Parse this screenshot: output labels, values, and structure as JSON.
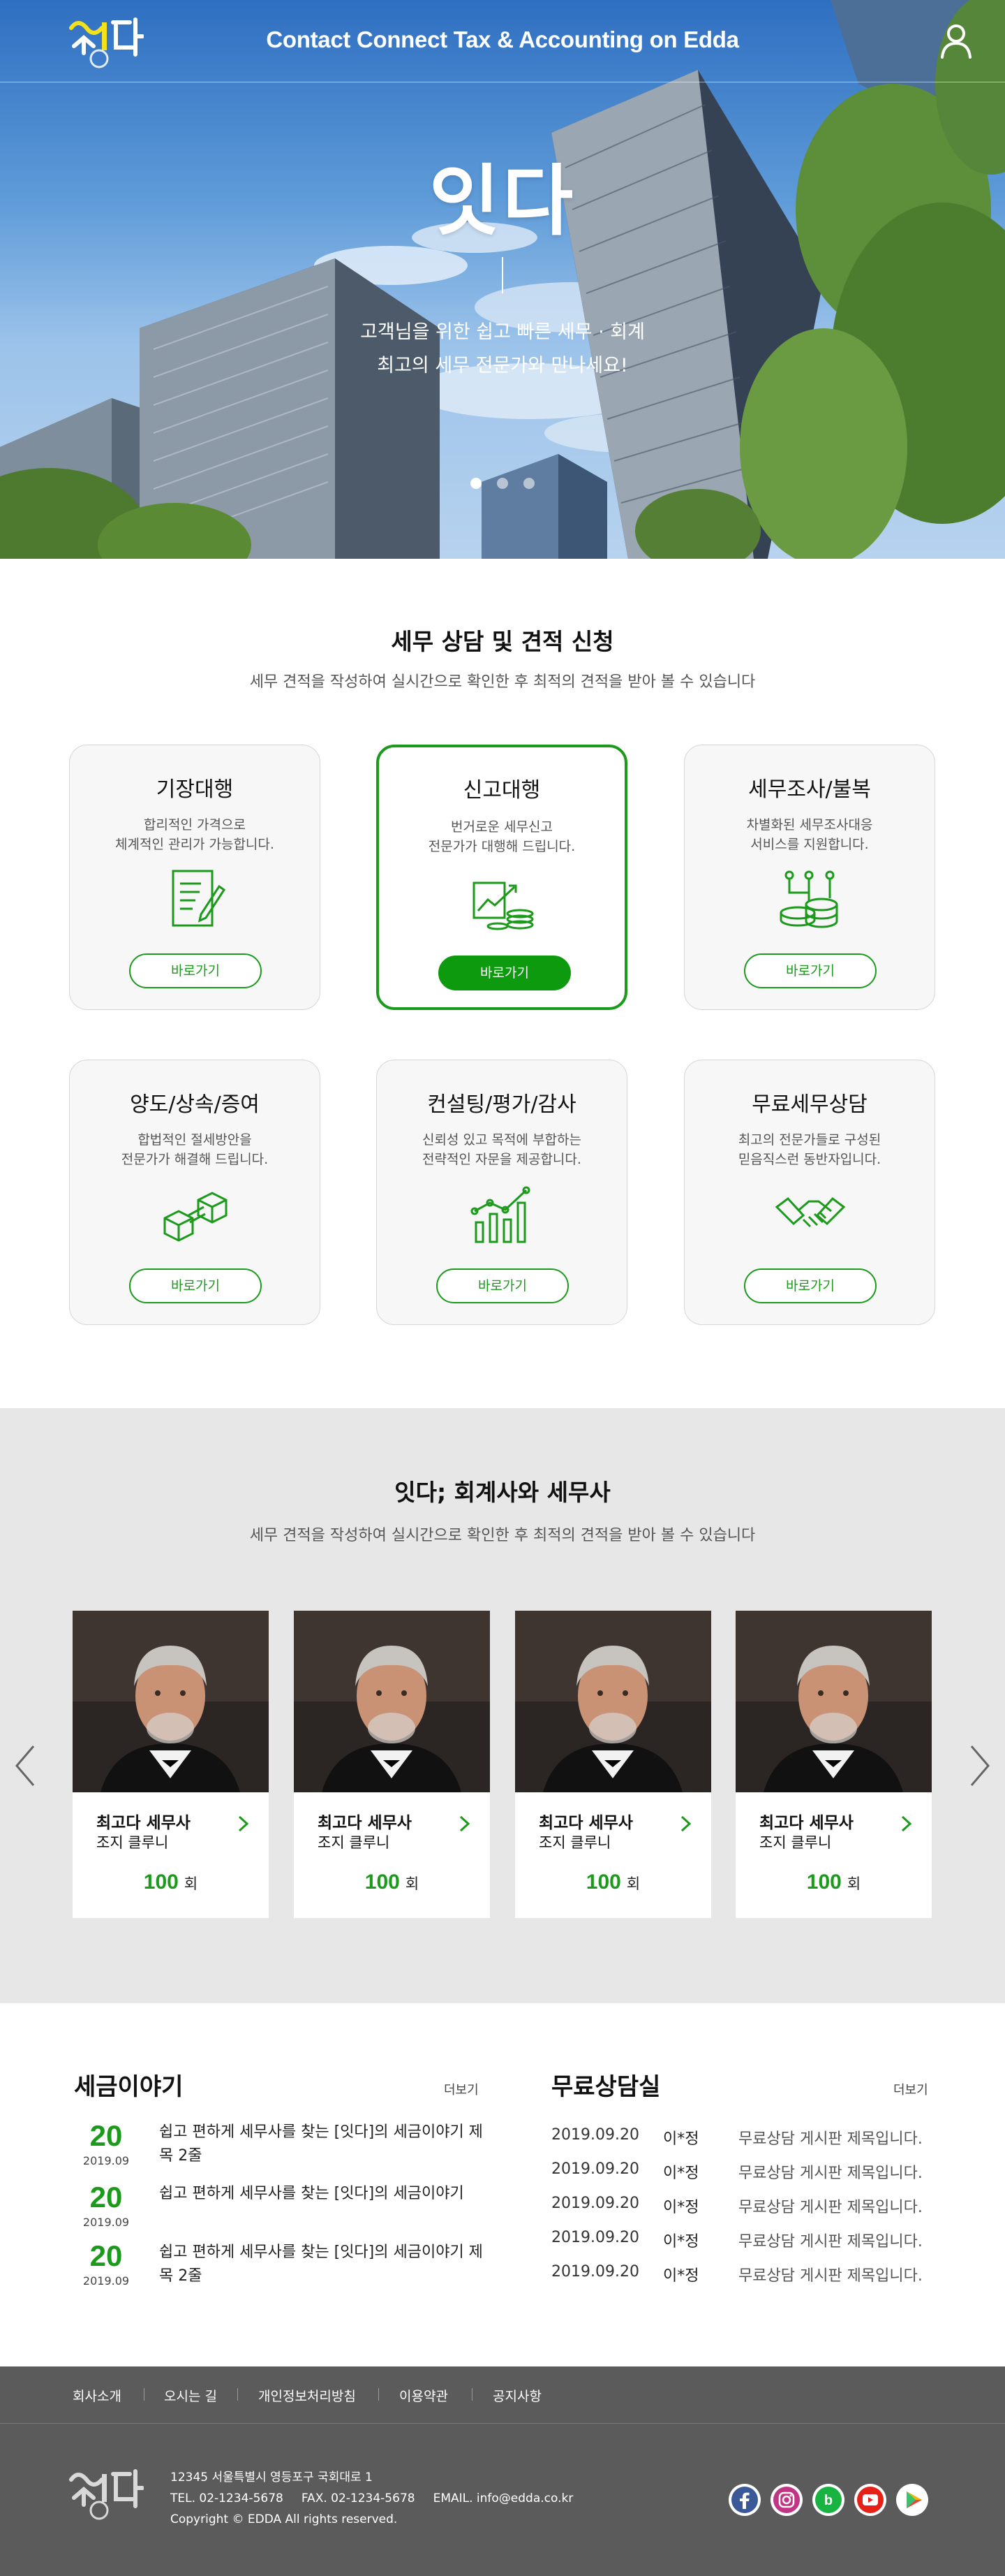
{
  "header": {
    "logo_text": "잇다",
    "nav_title": "Contact Connect Tax & Accounting on Edda",
    "user_icon": "user-icon"
  },
  "hero": {
    "title": "잇다",
    "subtitle_line1": "고객님을 위한 쉽고 빠른 세무 · 회계",
    "subtitle_line2": "최고의 세무 전문가와 만나세요!",
    "slides_total": 3,
    "active_slide": 1
  },
  "services": {
    "title": "세무 상담 및 견적 신청",
    "subtitle": "세무 견적을 작성하여 실시간으로 확인한 후 최적의 견적을 받아 볼 수 있습니다",
    "accent_color": "#1c9a1c",
    "cards": [
      {
        "title": "기장대행",
        "desc1": "합리적인 가격으로",
        "desc2": "체계적인 관리가 가능합니다.",
        "icon": "document-pen-icon",
        "button": "바로가기",
        "active": false
      },
      {
        "title": "신고대행",
        "desc1": "번거로운 세무신고",
        "desc2": "전문가가 대행해 드립니다.",
        "icon": "chart-coins-icon",
        "button": "바로가기",
        "active": true
      },
      {
        "title": "세무조사/불복",
        "desc1": "차별화된 세무조사대응",
        "desc2": "서비스를 지원합니다.",
        "icon": "coin-stack-icon",
        "button": "바로가기",
        "active": false
      },
      {
        "title": "양도/상속/증여",
        "desc1": "합법적인 절세방안을",
        "desc2": "전문가가 해결해 드립니다.",
        "icon": "boxes-transfer-icon",
        "button": "바로가기",
        "active": false
      },
      {
        "title": "컨설팅/평가/감사",
        "desc1": "신뢰성 있고 목적에 부합하는",
        "desc2": "전략적인 자문을 제공합니다.",
        "icon": "bar-growth-icon",
        "button": "바로가기",
        "active": false
      },
      {
        "title": "무료세무상담",
        "desc1": "최고의 전문가들로 구성된",
        "desc2": "믿음직스런 동반자입니다.",
        "icon": "handshake-icon",
        "button": "바로가기",
        "active": false
      }
    ]
  },
  "experts": {
    "title": "잇다; 회계사와 세무사",
    "subtitle": "세무 견적을 작성하여 실시간으로 확인한 후 최적의 견적을 받아 볼 수 있습니다",
    "prev_icon": "chevron-left-icon",
    "next_icon": "chevron-right-icon",
    "items": [
      {
        "role": "최고다 세무사",
        "name": "조지 클루니",
        "count": "100",
        "unit": "회"
      },
      {
        "role": "최고다 세무사",
        "name": "조지 클루니",
        "count": "100",
        "unit": "회"
      },
      {
        "role": "최고다 세무사",
        "name": "조지 클루니",
        "count": "100",
        "unit": "회"
      },
      {
        "role": "최고다 세무사",
        "name": "조지 클루니",
        "count": "100",
        "unit": "회"
      }
    ]
  },
  "tax_story": {
    "title": "세금이야기",
    "more": "더보기",
    "items": [
      {
        "day": "20",
        "ym": "2019.09",
        "text": "쉽고 편하게 세무사를 찾는 [잇다]의 세금이야기 제목 2줄"
      },
      {
        "day": "20",
        "ym": "2019.09",
        "text": "쉽고 편하게 세무사를 찾는 [잇다]의 세금이야기"
      },
      {
        "day": "20",
        "ym": "2019.09",
        "text": "쉽고 편하게 세무사를 찾는 [잇다]의 세금이야기 제목 2줄"
      }
    ]
  },
  "free_consult": {
    "title": "무료상담실",
    "more": "더보기",
    "rows": [
      {
        "date": "2019.09.20",
        "name": "이*정",
        "title": "무료상담 게시판 제목입니다."
      },
      {
        "date": "2019.09.20",
        "name": "이*정",
        "title": "무료상담 게시판 제목입니다."
      },
      {
        "date": "2019.09.20",
        "name": "이*정",
        "title": "무료상담 게시판 제목입니다."
      },
      {
        "date": "2019.09.20",
        "name": "이*정",
        "title": "무료상담 게시판 제목입니다."
      },
      {
        "date": "2019.09.20",
        "name": "이*정",
        "title": "무료상담 게시판 제목입니다."
      }
    ]
  },
  "footer": {
    "links": [
      "회사소개",
      "오시는 길",
      "개인정보처리방침",
      "이용약관",
      "공지사항"
    ],
    "logo_text": "잇다",
    "address": "12345  서울특별시 영등포구 국회대로 1",
    "tel": "TEL. 02-1234-5678",
    "fax": "FAX.  02-1234-5678",
    "email": "EMAIL. info@edda.co.kr",
    "copyright": "Copyright © EDDA All rights reserved.",
    "social": [
      "facebook-icon",
      "instagram-icon",
      "blog-icon",
      "youtube-icon",
      "play-store-icon"
    ]
  }
}
